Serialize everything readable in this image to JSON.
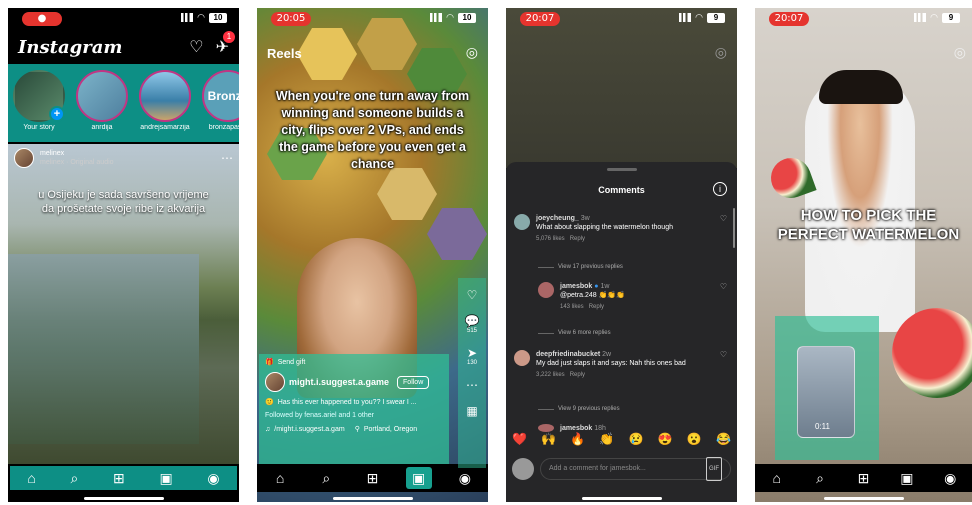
{
  "phone1": {
    "status": {
      "pill": "●",
      "battery": "10"
    },
    "app_title": "Instagram",
    "dm_badge": "1",
    "stories": [
      {
        "label": "Your story",
        "ring_text": ""
      },
      {
        "label": "anrdija",
        "ring_text": ""
      },
      {
        "label": "andrejsamarzija",
        "ring_text": ""
      },
      {
        "label": "bronzapasta",
        "ring_text": "Bronza"
      }
    ],
    "post": {
      "username": "melinex",
      "subtitle": "melinex · Original audio",
      "caption": "u Osijeku je sada savršeno vrijeme da prošetate svoje ribe iz akvarija"
    },
    "tabbar": [
      "home-icon",
      "search-icon",
      "create-icon",
      "reels-icon",
      "profile-icon"
    ]
  },
  "phone2": {
    "status": {
      "time": "20:05",
      "battery": "10"
    },
    "title": "Reels",
    "caption": "When you're one turn away from winning and someone builds a city, flips over 2 VPs, and ends the game before you even get a chance",
    "gift_label": "Send gift",
    "handle": "might.i.suggest.a.game",
    "follow_label": "Follow",
    "description": "Has this ever happened to you?? I swear I ...",
    "followed_by": "Followed by fenas.ariel and 1 other",
    "audio": "/might.i.suggest.a.gam",
    "location": "Portland, Oregon",
    "side_counts": {
      "comments": "515",
      "shares": "130"
    }
  },
  "phone3": {
    "status": {
      "time": "20:07",
      "battery": "9"
    },
    "sheet_title": "Comments",
    "comments": [
      {
        "user": "joeycheung_",
        "time": "3w",
        "text": "What about slapping the watermelon though",
        "likes": "5,076 likes",
        "reply": "Reply"
      },
      {
        "user": "jamesbok",
        "time": "1w",
        "text": "@petra.248 👏👏👏",
        "likes": "143 likes",
        "reply": "Reply"
      },
      {
        "user": "deepfriedinabucket",
        "time": "2w",
        "text": "My dad just slaps it and says: Nah this ones bad",
        "likes": "3,222 likes",
        "reply": "Reply"
      },
      {
        "user": "jamesbok",
        "time": "18h",
        "text": "",
        "likes": "",
        "reply": ""
      }
    ],
    "view_more": [
      "View 17 previous replies",
      "View 6 more replies",
      "View 9 previous replies"
    ],
    "emojis": [
      "❤️",
      "🙌",
      "🔥",
      "👏",
      "😢",
      "😍",
      "😮",
      "😂"
    ],
    "input_placeholder": "Add a comment for jamesbok...",
    "gif_label": "GIF"
  },
  "phone4": {
    "status": {
      "time": "20:07",
      "battery": "9"
    },
    "caption": "HOW TO PICK THE PERFECT WATERMELON",
    "pip_time": "0:11"
  }
}
